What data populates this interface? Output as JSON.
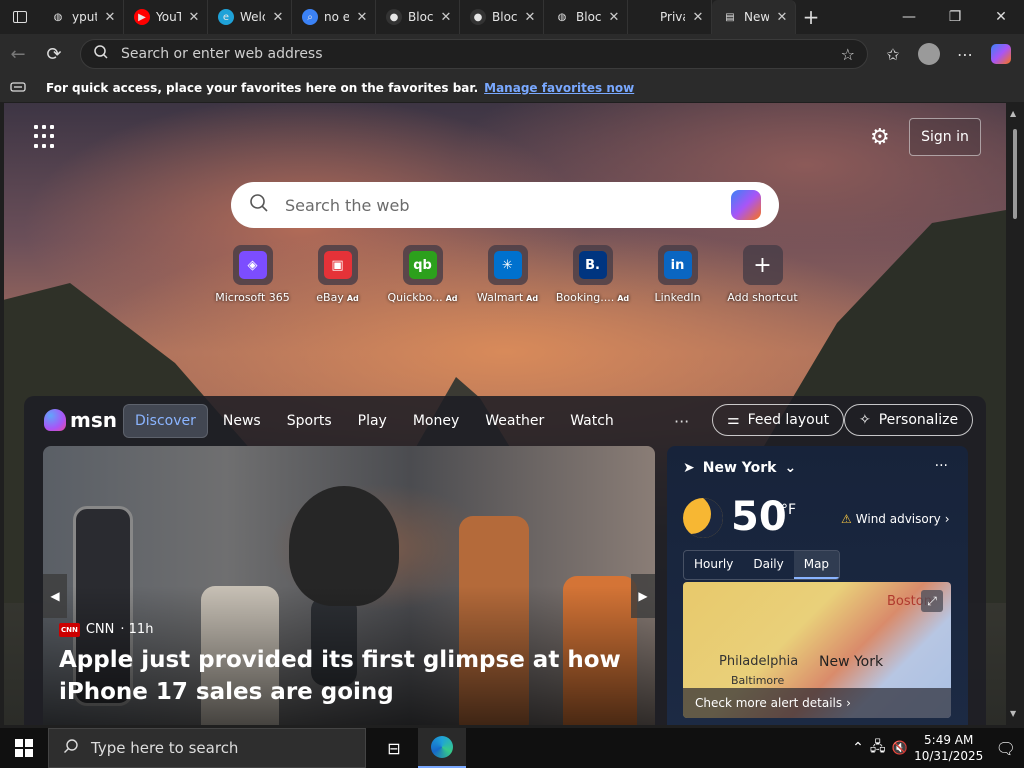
{
  "tabs": [
    {
      "title": "ypute",
      "favicon": "globe-icon"
    },
    {
      "title": "YouT",
      "favicon": "youtube-icon"
    },
    {
      "title": "Welc",
      "favicon": "edge-icon"
    },
    {
      "title": "no e",
      "favicon": "search-icon"
    },
    {
      "title": "Bloc",
      "favicon": "github-icon"
    },
    {
      "title": "Bloc",
      "favicon": "github-icon"
    },
    {
      "title": "Bloc",
      "favicon": "globe-icon"
    },
    {
      "title": "Privacy e",
      "favicon": ""
    },
    {
      "title": "New",
      "favicon": "newtab-icon"
    }
  ],
  "toolbar": {
    "address_placeholder": "Search or enter web address"
  },
  "favbar": {
    "message": "For quick access, place your favorites here on the favorites bar.",
    "link": "Manage favorites now"
  },
  "header": {
    "sign_in": "Sign in"
  },
  "search": {
    "placeholder": "Search the web"
  },
  "shortcuts": [
    {
      "label": "Microsoft 365",
      "ad": "",
      "icon": "microsoft365-icon",
      "glyph": "◈",
      "color": "#7c4dff"
    },
    {
      "label": "eBay",
      "ad": "Ad",
      "icon": "ebay-icon",
      "glyph": "▣",
      "color": "#e53238"
    },
    {
      "label": "Quickbo...",
      "ad": "Ad",
      "icon": "quickbooks-icon",
      "glyph": "qb",
      "color": "#2ca01c"
    },
    {
      "label": "Walmart",
      "ad": "Ad",
      "icon": "walmart-icon",
      "glyph": "✳",
      "color": "#0071ce"
    },
    {
      "label": "Booking....",
      "ad": "Ad",
      "icon": "booking-icon",
      "glyph": "B.",
      "color": "#003580"
    },
    {
      "label": "LinkedIn",
      "ad": "",
      "icon": "linkedin-icon",
      "glyph": "in",
      "color": "#0a66c2"
    },
    {
      "label": "Add shortcut",
      "ad": "",
      "icon": "plus-icon",
      "glyph": "+",
      "color": "transparent"
    }
  ],
  "msn": {
    "logo": "msn",
    "tabs": [
      "Discover",
      "News",
      "Sports",
      "Play",
      "Money",
      "Weather",
      "Watch"
    ],
    "feed_layout": "Feed layout",
    "personalize": "Personalize"
  },
  "hero": {
    "source": "CNN",
    "age": "· 11h",
    "headline": "Apple just provided its first glimpse at how iPhone 17 sales are going"
  },
  "weather": {
    "location": "New York",
    "temperature": "50",
    "unit": "°F",
    "advisory": "Wind advisory",
    "tabs": [
      "Hourly",
      "Daily",
      "Map"
    ],
    "cities": [
      "Boston",
      "Philadelphia",
      "New York",
      "Baltimore"
    ],
    "alert_link": "Check more alert details"
  },
  "taskbar": {
    "search_placeholder": "Type here to search",
    "time": "5:49 AM",
    "date": "10/31/2025"
  }
}
